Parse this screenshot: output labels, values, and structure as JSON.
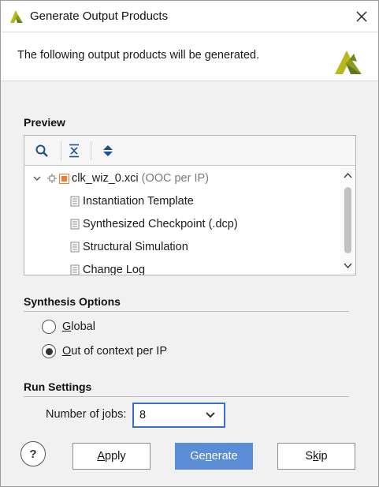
{
  "window": {
    "title": "Generate Output Products",
    "close_icon": "close-icon",
    "logo_icon": "vivado-logo-icon"
  },
  "header": {
    "intro": "The following output products will be generated.",
    "logo_icon": "vivado-logo-icon"
  },
  "preview": {
    "title": "Preview",
    "toolbar": [
      "search-icon",
      "collapse-all-icon",
      "expand-all-icon"
    ],
    "root": {
      "name": "clk_wiz_0.xci",
      "suffix": "(OOC per IP)",
      "expanded": true
    },
    "children": [
      "Instantiation Template",
      "Synthesized Checkpoint (.dcp)",
      "Structural Simulation",
      "Change Log"
    ]
  },
  "synthesis": {
    "title": "Synthesis Options",
    "options": [
      {
        "mnemonic": "G",
        "rest": "lobal",
        "selected": false
      },
      {
        "mnemonic": "O",
        "rest": "ut of context per IP",
        "selected": true
      }
    ]
  },
  "run": {
    "title": "Run Settings",
    "jobs_label": "Number of jobs:",
    "jobs_value": "8"
  },
  "buttons": {
    "help": "?",
    "apply": {
      "pre": "",
      "mnemonic": "A",
      "rest": "pply"
    },
    "generate": {
      "pre": "Ge",
      "mnemonic": "n",
      "rest": "erate"
    },
    "skip": {
      "pre": "S",
      "mnemonic": "k",
      "rest": "ip"
    }
  },
  "colors": {
    "accent": "#5b8dd6",
    "focus_border": "#3a6fc4",
    "logo_yellow": "#b8b81a",
    "logo_green": "#5e7a1a",
    "ip_orange": "#ef7d2d"
  }
}
